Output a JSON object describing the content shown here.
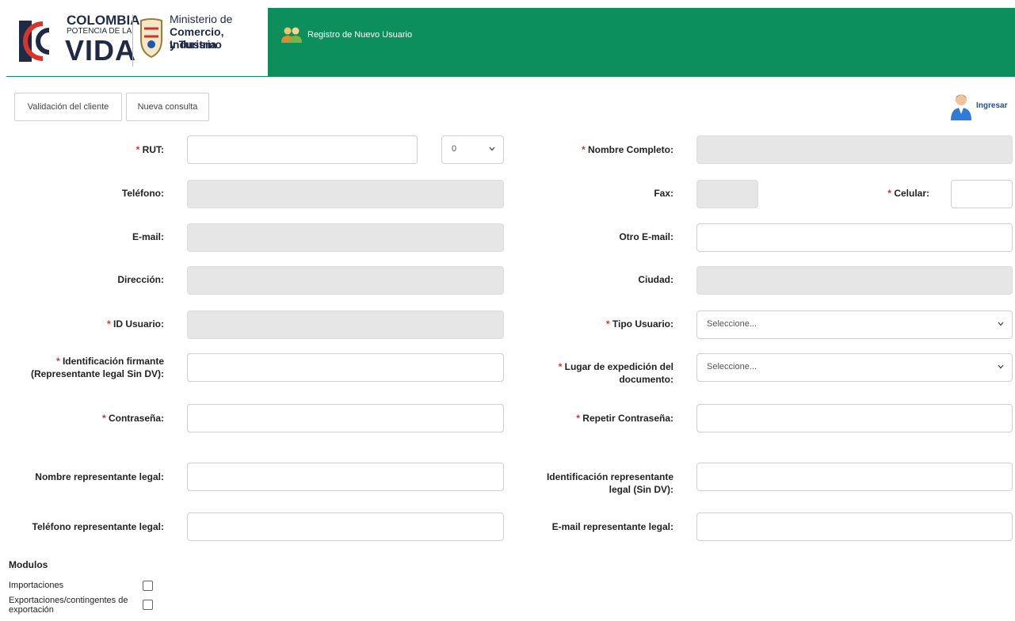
{
  "header": {
    "logo": {
      "colombia": "COLOMBIA",
      "potencia": "POTENCIA DE LA",
      "vida": "VIDA",
      "ministerio_1": "Ministerio de",
      "ministerio_2": "Comercio, Industria",
      "ministerio_3": "y Turismo"
    },
    "title": "Registro de Nuevo Usuario",
    "bg_color": "#0d8f5d"
  },
  "toolbar": {
    "validacion_label": "Validación del cliente",
    "nueva_consulta_label": "Nueva consulta",
    "ingresar_label": "Ingresar"
  },
  "form": {
    "required_mark": "*",
    "rut": {
      "label": "RUT:",
      "value": "",
      "dv_value": "0"
    },
    "nombre_completo": {
      "label": "Nombre Completo:",
      "value": ""
    },
    "telefono": {
      "label": "Teléfono:",
      "value": ""
    },
    "fax": {
      "label": "Fax:",
      "value": ""
    },
    "celular": {
      "label": "Celular:",
      "value": ""
    },
    "email": {
      "label": "E-mail:",
      "value": ""
    },
    "otro_email": {
      "label": "Otro E-mail:",
      "value": ""
    },
    "direccion": {
      "label": "Dirección:",
      "value": ""
    },
    "ciudad": {
      "label": "Ciudad:",
      "value": ""
    },
    "id_usuario": {
      "label": "ID Usuario:",
      "value": ""
    },
    "tipo_usuario": {
      "label": "Tipo Usuario:",
      "value": "Seleccione..."
    },
    "identificacion_firmante": {
      "label_1": "Identificación firmante",
      "label_2": "(Representante legal Sin DV):",
      "value": ""
    },
    "lugar_expedicion": {
      "label_1": "Lugar de expedición del",
      "label_2": "documento:",
      "value": "Seleccione..."
    },
    "contrasena": {
      "label": "Contraseña:",
      "value": ""
    },
    "repetir_contrasena": {
      "label": "Repetir Contraseña:",
      "value": ""
    },
    "nombre_representante": {
      "label": "Nombre representante legal:",
      "value": ""
    },
    "identificacion_representante": {
      "label_1": "Identificación representante",
      "label_2": "legal (Sin DV):",
      "value": ""
    },
    "telefono_representante": {
      "label": "Teléfono representante legal:",
      "value": ""
    },
    "email_representante": {
      "label": "E-mail representante legal:",
      "value": ""
    }
  },
  "modulos": {
    "title": "Modulos",
    "items": [
      {
        "label_1": "Importaciones",
        "label_2": ""
      },
      {
        "label_1": "Exportaciones/contingentes de",
        "label_2": "exportación"
      }
    ]
  }
}
